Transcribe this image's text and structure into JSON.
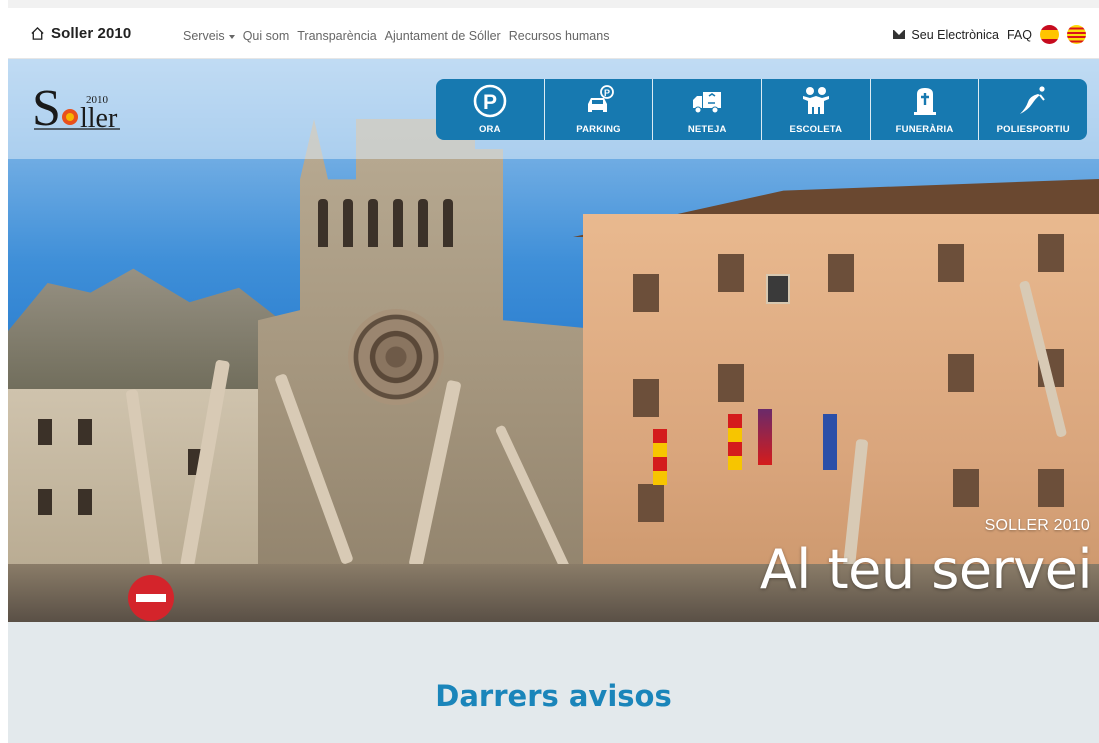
{
  "navbar": {
    "brand": "Soller 2010",
    "links": [
      {
        "label": "Serveis",
        "dropdown": true
      },
      {
        "label": "Qui som",
        "dropdown": false
      },
      {
        "label": "Transparència",
        "dropdown": false
      },
      {
        "label": "Ajuntament de Sóller",
        "dropdown": false
      },
      {
        "label": "Recursos humans",
        "dropdown": false
      }
    ],
    "seu_label": "Seu Electrònica",
    "faq_label": "FAQ",
    "flags": [
      "flag-spain-icon",
      "flag-catalonia-icon"
    ]
  },
  "logo": {
    "letter_s": "S",
    "year": "2010",
    "rest": "ller"
  },
  "services": [
    {
      "label": "ORA",
      "icon": "parking-p-icon"
    },
    {
      "label": "PARKING",
      "icon": "car-parking-icon"
    },
    {
      "label": "NETEJA",
      "icon": "recycling-truck-icon"
    },
    {
      "label": "ESCOLETA",
      "icon": "children-icon"
    },
    {
      "label": "FUNERÀRIA",
      "icon": "tombstone-icon"
    },
    {
      "label": "POLIESPORTIU",
      "icon": "runner-icon"
    }
  ],
  "hero": {
    "subtitle": "SOLLER 2010",
    "title": "Al teu servei"
  },
  "avisos": {
    "title": "Darrers avisos"
  },
  "colors": {
    "brand_blue": "#1779b0",
    "heading_blue": "#1a85ba",
    "section_bg": "#e3e9ec"
  }
}
